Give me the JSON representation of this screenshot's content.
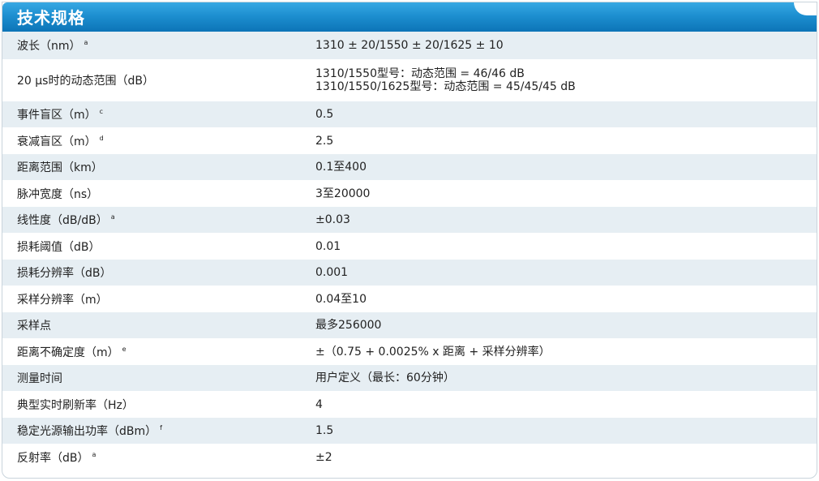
{
  "title": "技术规格",
  "rows": [
    {
      "param": "波长（nm）",
      "note": "a",
      "spec": [
        "1310 ± 20/1550 ± 20/1625 ± 10"
      ]
    },
    {
      "param": "20 μs时的动态范围（dB）",
      "note": "",
      "spec": [
        "1310/1550型号：动态范围 = 46/46 dB",
        "1310/1550/1625型号：动态范围 = 45/45/45 dB"
      ]
    },
    {
      "param": "事件盲区（m）",
      "note": "c",
      "spec": [
        "0.5"
      ]
    },
    {
      "param": "衰减盲区（m）",
      "note": "d",
      "spec": [
        "2.5"
      ]
    },
    {
      "param": "距离范围（km）",
      "note": "",
      "spec": [
        "0.1至400"
      ]
    },
    {
      "param": "脉冲宽度（ns）",
      "note": "",
      "spec": [
        "3至20000"
      ]
    },
    {
      "param": "线性度（dB/dB）",
      "note": "a",
      "spec": [
        "±0.03"
      ]
    },
    {
      "param": "损耗阈值（dB）",
      "note": "",
      "spec": [
        "0.01"
      ]
    },
    {
      "param": "损耗分辨率（dB）",
      "note": "",
      "spec": [
        "0.001"
      ]
    },
    {
      "param": "采样分辨率（m）",
      "note": "",
      "spec": [
        "0.04至10"
      ]
    },
    {
      "param": "采样点",
      "note": "",
      "spec": [
        "最多256000"
      ]
    },
    {
      "param": "距离不确定度（m）",
      "note": "e",
      "spec": [
        "±（0.75 + 0.0025% x 距离 + 采样分辨率）"
      ]
    },
    {
      "param": "测量时间",
      "note": "",
      "spec": [
        "用户定义（最长：60分钟）"
      ]
    },
    {
      "param": "典型实时刷新率（Hz）",
      "note": "",
      "spec": [
        "4"
      ]
    },
    {
      "param": "稳定光源输出功率（dBm）",
      "note": "f",
      "spec": [
        "1.5"
      ]
    },
    {
      "param": "反射率（dB）",
      "note": "a",
      "spec": [
        "±2"
      ]
    }
  ],
  "colors": {
    "header_top": "#38a8e3",
    "header_bottom": "#0c74b7",
    "row_shade": "#e6eef3"
  }
}
